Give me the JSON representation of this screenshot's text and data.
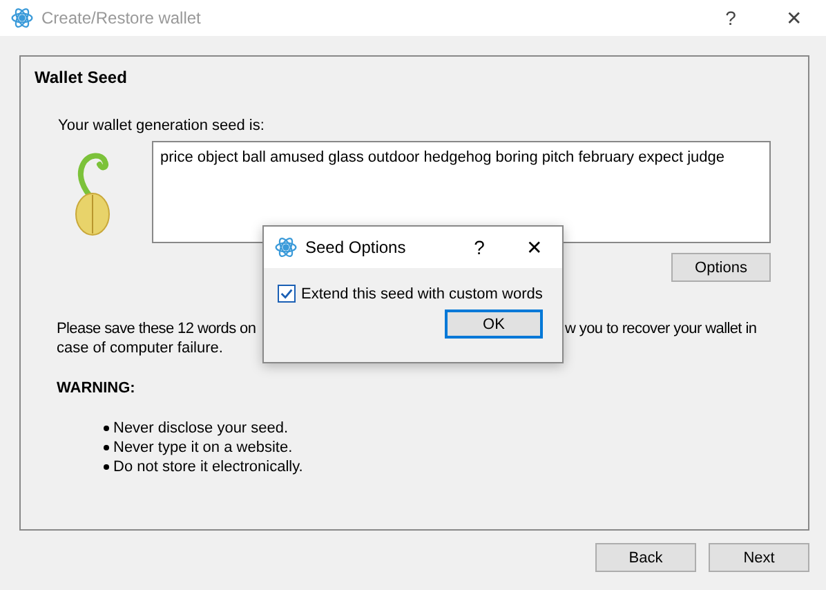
{
  "window": {
    "title": "Create/Restore wallet",
    "help": "?",
    "close": "✕"
  },
  "group": {
    "title": "Wallet Seed"
  },
  "seed_label": "Your wallet generation seed is:",
  "seed_text": "price object ball amused glass outdoor hedgehog boring pitch february expect judge",
  "options_button": "Options",
  "paragraph_parts": [
    "Please save these 12 words on",
    "w you to recover your wallet in",
    "case of computer failure."
  ],
  "warning_title": "WARNING:",
  "warnings": [
    "Never disclose your seed.",
    "Never type it on a website.",
    "Do not store it electronically."
  ],
  "buttons": [
    "Back",
    "Next"
  ],
  "dialog": {
    "title": "Seed Options",
    "help": "?",
    "close": "✕",
    "checkbox": {
      "label": "Extend this seed with custom words",
      "checked": true
    },
    "ok": "OK"
  }
}
